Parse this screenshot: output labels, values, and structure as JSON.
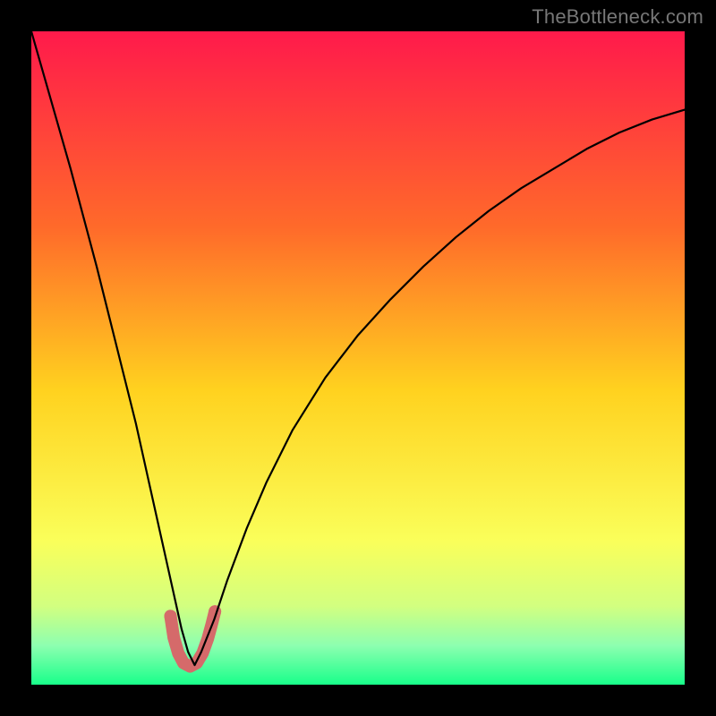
{
  "watermark": {
    "text": "TheBottleneck.com"
  },
  "chart_data": {
    "type": "line",
    "title": "",
    "xlabel": "",
    "ylabel": "",
    "xlim": [
      0,
      100
    ],
    "ylim": [
      0,
      100
    ],
    "gradient_background": {
      "stops": [
        {
          "offset": 0.0,
          "color": "#ff1a4b"
        },
        {
          "offset": 0.3,
          "color": "#ff6a2a"
        },
        {
          "offset": 0.55,
          "color": "#ffd21f"
        },
        {
          "offset": 0.78,
          "color": "#faff5a"
        },
        {
          "offset": 0.88,
          "color": "#d2ff80"
        },
        {
          "offset": 0.94,
          "color": "#8dffb0"
        },
        {
          "offset": 1.0,
          "color": "#18ff8a"
        }
      ]
    },
    "series": [
      {
        "name": "bottleneck-curve",
        "color": "#000000",
        "width": 2.2,
        "x": [
          0,
          2,
          4,
          6,
          8,
          10,
          12,
          14,
          16,
          18,
          20,
          22,
          23,
          24,
          25,
          26,
          28,
          30,
          33,
          36,
          40,
          45,
          50,
          55,
          60,
          65,
          70,
          75,
          80,
          85,
          90,
          95,
          100
        ],
        "y": [
          100,
          93,
          86,
          79,
          71.5,
          64,
          56,
          48,
          40,
          31,
          22,
          13,
          8.5,
          5,
          3,
          5,
          10,
          16,
          24,
          31,
          39,
          47,
          53.5,
          59,
          64,
          68.5,
          72.5,
          76,
          79,
          82,
          84.5,
          86.5,
          88
        ]
      }
    ],
    "highlight_band": {
      "name": "optimal-range",
      "color": "#d56a6a",
      "width": 14,
      "cap": "round",
      "x": [
        21.3,
        21.8,
        22.5,
        23.3,
        24.3,
        25.3,
        26.2,
        27.0,
        27.6,
        28.1
      ],
      "y": [
        10.5,
        7.2,
        4.8,
        3.3,
        2.8,
        3.3,
        4.8,
        7.0,
        9.2,
        11.2
      ]
    }
  }
}
